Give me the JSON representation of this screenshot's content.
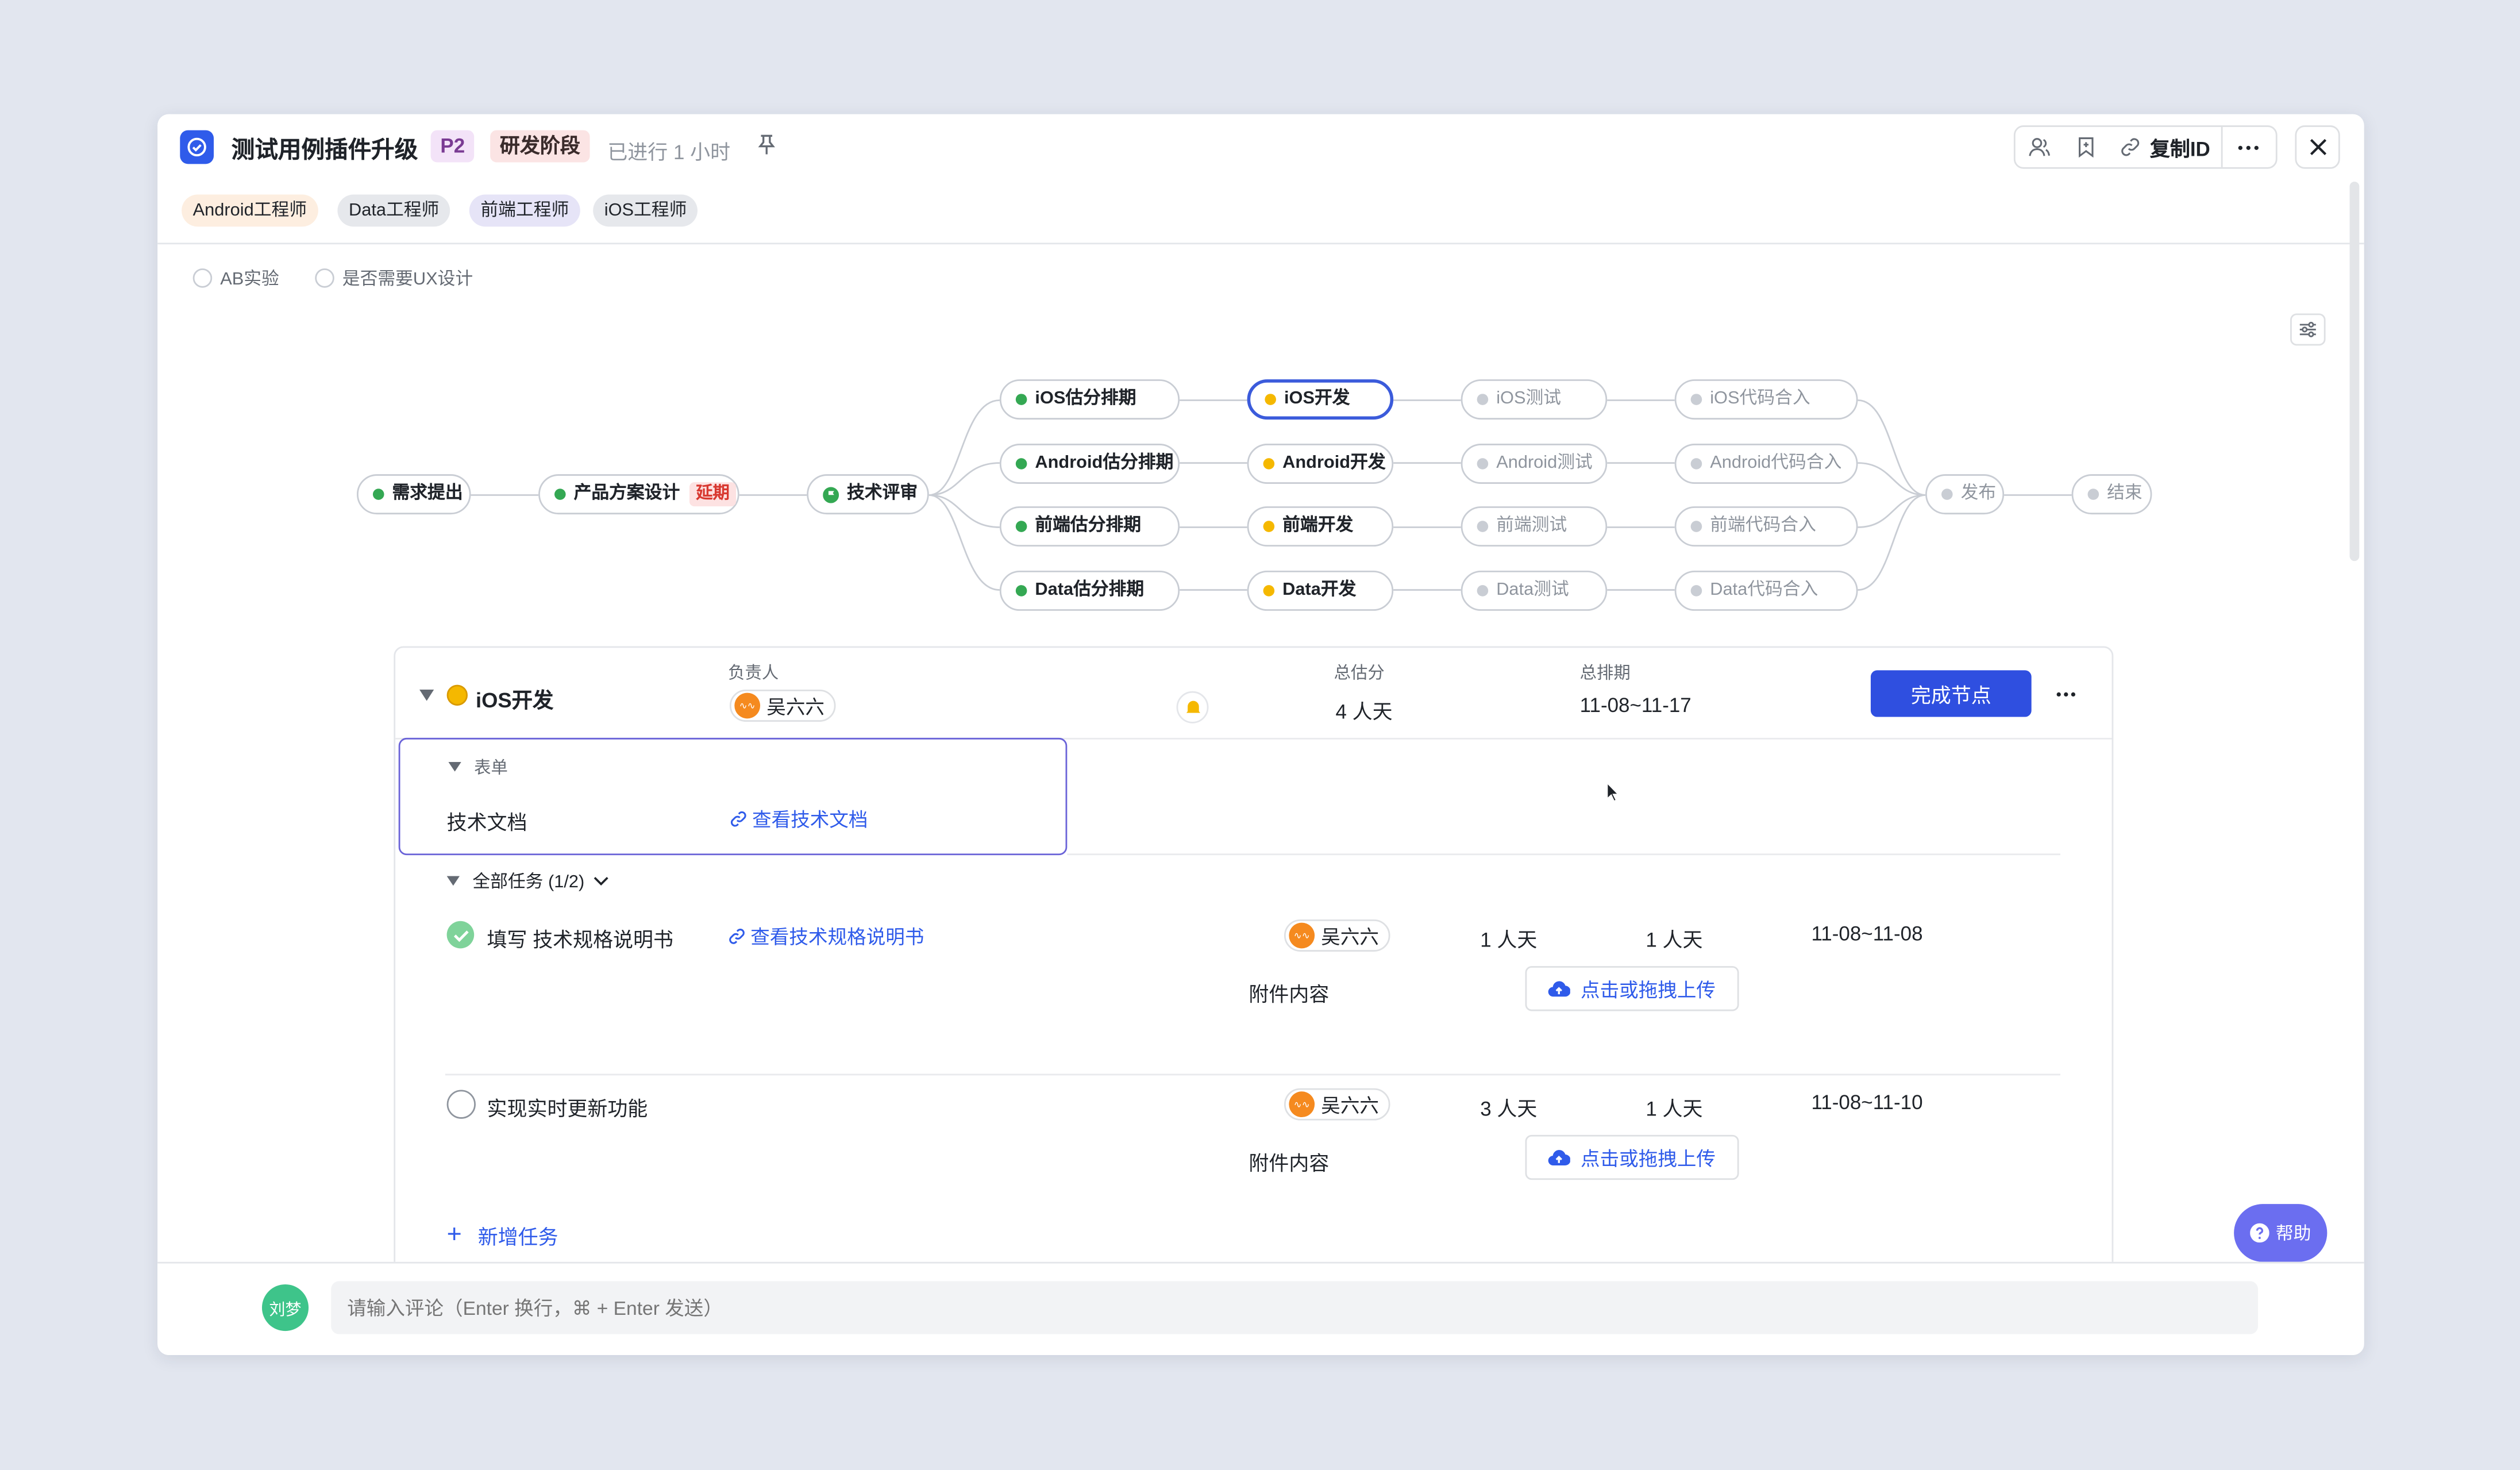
{
  "header": {
    "title": "测试用例插件升级",
    "priority": "P2",
    "stage": "研发阶段",
    "elapsed": "已进行 1 小时",
    "copy_id": "复制ID"
  },
  "roles": [
    "Android工程师",
    "Data工程师",
    "前端工程师",
    "iOS工程师"
  ],
  "checkboxes": [
    "AB实验",
    "是否需要UX设计"
  ],
  "flow": {
    "start": [
      "需求提出",
      "产品方案设计",
      "技术评审"
    ],
    "delay_badge": "延期",
    "estimate": [
      "iOS估分排期",
      "Android估分排期",
      "前端估分排期",
      "Data估分排期"
    ],
    "develop": [
      "iOS开发",
      "Android开发",
      "前端开发",
      "Data开发"
    ],
    "test": [
      "iOS测试",
      "Android测试",
      "前端测试",
      "Data测试"
    ],
    "merge": [
      "iOS代码合入",
      "Android代码合入",
      "前端代码合入",
      "Data代码合入"
    ],
    "end": [
      "发布",
      "结束"
    ]
  },
  "node": {
    "name": "iOS开发",
    "owner_label": "负责人",
    "owner": "吴六六",
    "estimate_label": "总估分",
    "estimate": "4 人天",
    "schedule_label": "总排期",
    "schedule": "11-08~11-17",
    "complete_button": "完成节点"
  },
  "form": {
    "title": "表单",
    "field": "技术文档",
    "link": "查看技术文档"
  },
  "tasks": {
    "title": "全部任务 (1/2)",
    "attachment_label": "附件内容",
    "upload_label": "点击或拖拽上传",
    "add_task": "新增任务",
    "items": [
      {
        "name": "填写 技术规格说明书",
        "link": "查看技术规格说明书",
        "owner": "吴六六",
        "estimate": "1 人天",
        "actual": "1 人天",
        "schedule": "11-08~11-08",
        "done": true
      },
      {
        "name": "实现实时更新功能",
        "link": "",
        "owner": "吴六六",
        "estimate": "3 人天",
        "actual": "1 人天",
        "schedule": "11-08~11-10",
        "done": false
      }
    ]
  },
  "comment": {
    "avatar": "刘梦",
    "placeholder": "请输入评论（Enter 换行，⌘ + Enter 发送）"
  },
  "help": "帮助"
}
